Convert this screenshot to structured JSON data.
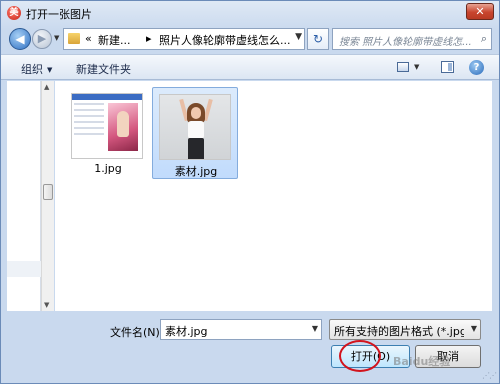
{
  "window": {
    "title": "打开一张图片",
    "close_glyph": "✕",
    "app_icon_glyph": "美"
  },
  "address_bar": {
    "chevron": "«",
    "crumbs": [
      "新建...",
      "照片人像轮廓带虚线怎么..."
    ],
    "separator": "▸"
  },
  "search": {
    "placeholder": "搜索 照片人像轮廓带虚线怎..."
  },
  "toolbar": {
    "organize_label": "组织",
    "new_folder_label": "新建文件夹"
  },
  "files": [
    {
      "name": "1.jpg",
      "selected": false
    },
    {
      "name": "素材.jpg",
      "selected": true
    }
  ],
  "bottom": {
    "filename_label": "文件名(N):",
    "filename_value": "素材.jpg",
    "filetype_value": "所有支持的图片格式 (*.jpg;*.jp",
    "open_button": "打开(O)",
    "cancel_button": "取消"
  },
  "watermark": "Baidu经验",
  "colors": {
    "highlight_ring": "#d2141d",
    "selection": "#c1dbfc",
    "window_frame": "#c9d9ee"
  }
}
